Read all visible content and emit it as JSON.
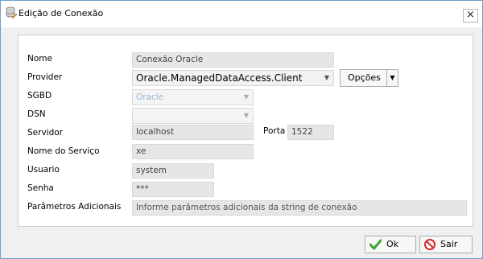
{
  "window": {
    "title": "Edição de Conexão",
    "close_glyph": "×"
  },
  "form": {
    "nome_label": "Nome",
    "nome_value": "Conexão Oracle",
    "provider_label": "Provider",
    "provider_value": "Oracle.ManagedDataAccess.Client",
    "opcoes_label": "Opções",
    "sgbd_label": "SGBD",
    "sgbd_value": "Oracle",
    "dsn_label": "DSN",
    "dsn_value": "",
    "servidor_label": "Servidor",
    "servidor_value": "localhost",
    "porta_label": "Porta",
    "porta_value": "1522",
    "servico_label": "Nome do Serviço",
    "servico_value": "xe",
    "usuario_label": "Usuario",
    "usuario_value": "system",
    "senha_label": "Senha",
    "senha_value": "***",
    "params_label": "Parâmetros Adicionais",
    "params_placeholder": "Informe parâmetros adicionais da string de conexão"
  },
  "buttons": {
    "ok_label": "Ok",
    "sair_label": "Sair"
  },
  "icons": {
    "ok": "checkmark-icon",
    "sair": "no-entry-icon",
    "dropdown": "triangle-down-icon"
  },
  "colors": {
    "accent": "#6fa0c8",
    "ok_green": "#3aa635",
    "sair_red": "#d32b2b",
    "sgbd_text": "#9ab7d6"
  }
}
